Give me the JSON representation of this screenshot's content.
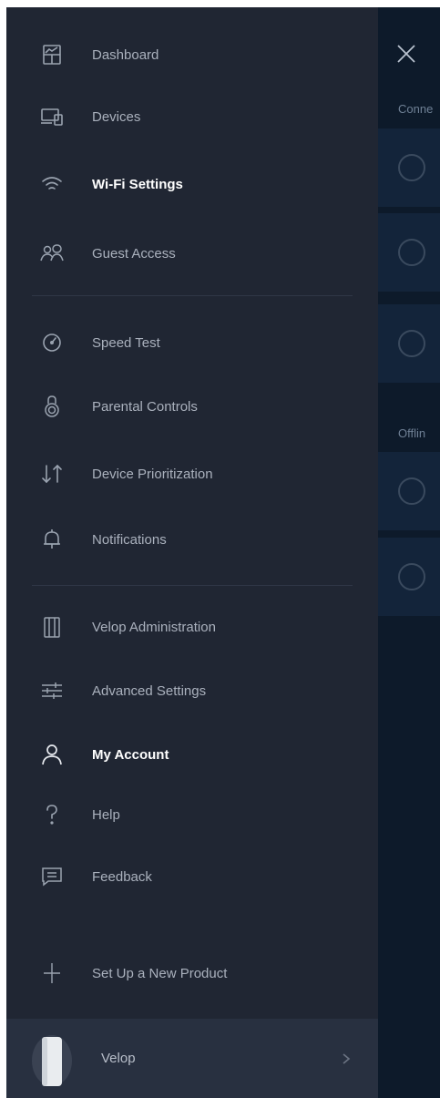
{
  "menu": {
    "items": [
      {
        "label": "Dashboard",
        "icon": "dashboard-icon"
      },
      {
        "label": "Devices",
        "icon": "devices-icon"
      },
      {
        "label": "Wi-Fi Settings",
        "icon": "wifi-icon"
      },
      {
        "label": "Guest Access",
        "icon": "guest-access-icon"
      },
      {
        "label": "Speed Test",
        "icon": "speedometer-icon"
      },
      {
        "label": "Parental Controls",
        "icon": "parental-controls-icon"
      },
      {
        "label": "Device Prioritization",
        "icon": "prioritization-arrows-icon"
      },
      {
        "label": "Notifications",
        "icon": "bell-icon"
      },
      {
        "label": "Velop Administration",
        "icon": "velop-node-icon"
      },
      {
        "label": "Advanced Settings",
        "icon": "sliders-icon"
      },
      {
        "label": "My Account",
        "icon": "person-icon",
        "active": true
      },
      {
        "label": "Help",
        "icon": "question-mark-icon"
      },
      {
        "label": "Feedback",
        "icon": "feedback-icon"
      },
      {
        "label": "Set Up a New Product",
        "icon": "plus-icon"
      }
    ]
  },
  "router": {
    "label": "Velop",
    "icon": "velop-device-image"
  },
  "panel": {
    "close_icon": "close-icon",
    "section_online": "Conne",
    "section_offline": "Offlin"
  },
  "colors": {
    "drawer_bg": "#202633",
    "panel_bg": "#0d1a2a",
    "card_bg": "#13243a",
    "text_muted": "#aab1bd",
    "text_active": "#ffffff"
  }
}
